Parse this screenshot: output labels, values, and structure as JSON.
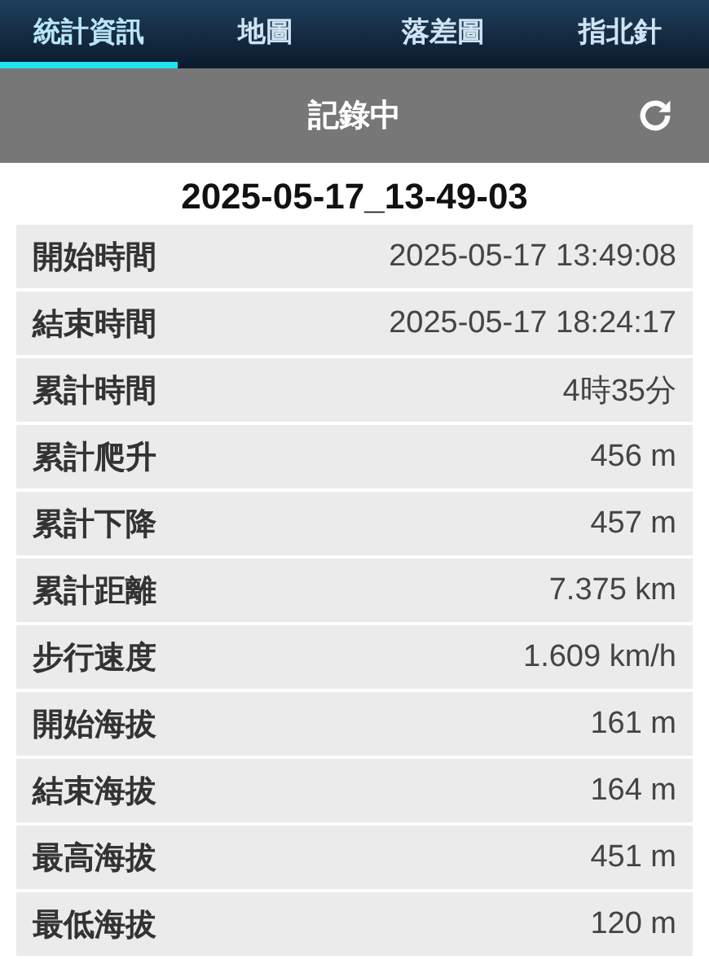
{
  "tabs": [
    {
      "label": "統計資訊",
      "selected": true
    },
    {
      "label": "地圖",
      "selected": false
    },
    {
      "label": "落差圖",
      "selected": false
    },
    {
      "label": "指北針",
      "selected": false
    }
  ],
  "header": {
    "title": "記錄中"
  },
  "record_name": "2025-05-17_13-49-03",
  "stats": [
    {
      "label": "開始時間",
      "value": "2025-05-17 13:49:08"
    },
    {
      "label": "結束時間",
      "value": "2025-05-17 18:24:17"
    },
    {
      "label": "累計時間",
      "value": "4時35分"
    },
    {
      "label": "累計爬升",
      "value": "456 m"
    },
    {
      "label": "累計下降",
      "value": "457 m"
    },
    {
      "label": "累計距離",
      "value": "7.375 km"
    },
    {
      "label": "步行速度",
      "value": "1.609 km/h"
    },
    {
      "label": "開始海拔",
      "value": "161 m"
    },
    {
      "label": "結束海拔",
      "value": "164 m"
    },
    {
      "label": "最高海拔",
      "value": "451 m"
    },
    {
      "label": "最低海拔",
      "value": "120 m"
    }
  ]
}
